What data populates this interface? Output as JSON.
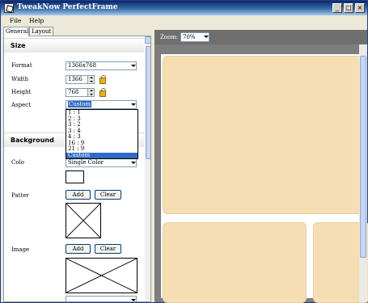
{
  "window": {
    "title": "TweakNow PerfectFrame",
    "controls": {
      "minimize": "_",
      "maximize": "□",
      "close": "×"
    }
  },
  "menu": {
    "items": [
      "File",
      "Help"
    ]
  },
  "tabs": [
    {
      "label": "General",
      "active": true
    },
    {
      "label": "Layout",
      "active": false
    }
  ],
  "size_section": {
    "header": "Size",
    "format": {
      "label": "Format",
      "value": "1366x768"
    },
    "width": {
      "label": "Width",
      "value": "1366"
    },
    "height": {
      "label": "Height",
      "value": "768"
    },
    "aspect": {
      "label": "Aspect",
      "value": "Custom",
      "options": [
        "1 : 1",
        "2 : 3",
        "3 : 2",
        "3 : 4",
        "4 : 3",
        "16 : 9",
        "21 : 9",
        "Custom"
      ],
      "selected_index": 7
    }
  },
  "background_section": {
    "header": "Background",
    "color": {
      "label": "Colo",
      "value": "Single Color"
    },
    "pattern": {
      "label": "Patter",
      "add_label": "Add",
      "clear_label": "Clear"
    },
    "image": {
      "label": "Image",
      "add_label": "Add",
      "clear_label": "Clear"
    }
  },
  "preview": {
    "zoom_label": "Zoom:",
    "zoom_value": "70%",
    "frame_color": "#f5deb3",
    "canvas_color": "#ffffff",
    "backdrop_color": "#7d7d7d"
  }
}
